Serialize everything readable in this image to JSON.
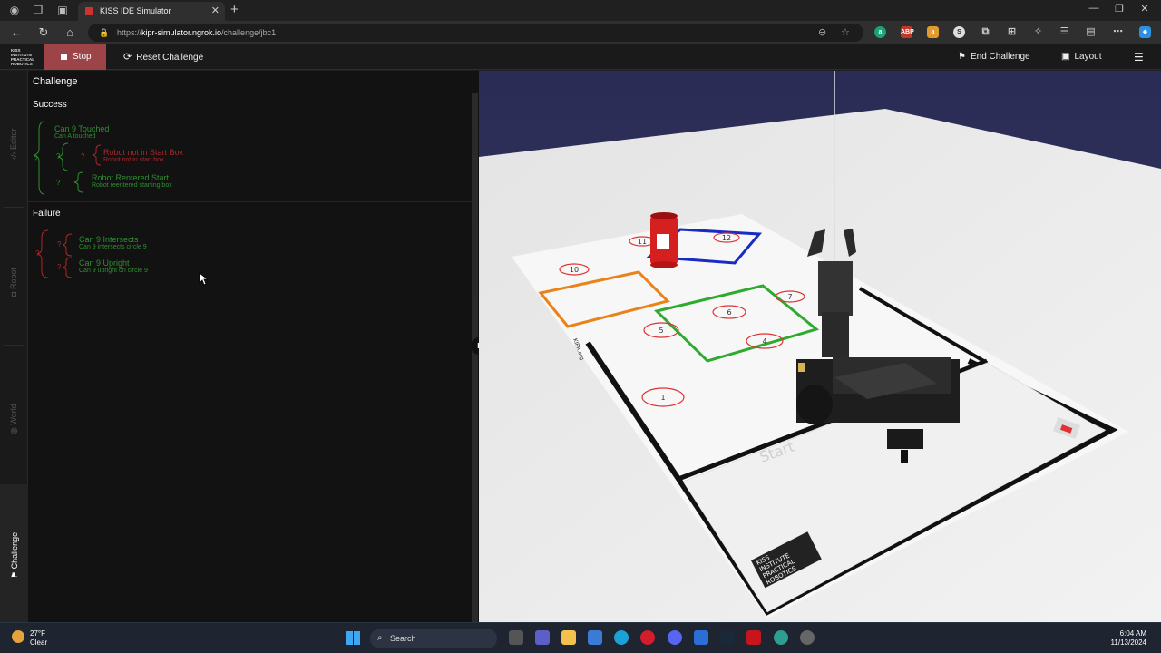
{
  "browser": {
    "tab_title": "KISS IDE Simulator",
    "url_prefix": "https://",
    "url_host": "kipr-simulator.ngrok.io",
    "url_path": "/challenge/jbc1"
  },
  "toolbar": {
    "stop_label": "Stop",
    "reset_label": "Reset Challenge",
    "end_label": "End Challenge",
    "layout_label": "Layout"
  },
  "logo_lines": [
    "KISS",
    "INSTITUTE",
    "PRACTICAL",
    "ROBOTICS"
  ],
  "side_tabs": {
    "editor": "Editor",
    "robot": "Robot",
    "world": "World",
    "challenge": "Challenge"
  },
  "panel": {
    "title": "Challenge",
    "success": {
      "title": "Success",
      "can_touched": {
        "name": "Can 9 Touched",
        "desc": "Can A touched"
      },
      "not_in_start": {
        "name": "Robot not in Start Box",
        "desc": "Robot not in start box"
      },
      "reentered": {
        "name": "Robot Rentered Start",
        "desc": "Robot reentered starting box"
      }
    },
    "failure": {
      "title": "Failure",
      "intersects": {
        "name": "Can 9 Intersects",
        "desc": "Can 9 intersects circle 9"
      },
      "upright": {
        "name": "Can 9 Upright",
        "desc": "Can 9 upright on circle 9"
      }
    },
    "q": "?"
  },
  "scene": {
    "start_label": "Start",
    "circles": [
      "1",
      "4",
      "5",
      "6",
      "7",
      "10",
      "11",
      "12"
    ],
    "mat_logo": [
      "KISS",
      "INSTITUTE",
      "PRACTICAL",
      "ROBOTICS"
    ],
    "mat_side": "KIPR.org"
  },
  "taskbar": {
    "temp": "27°F",
    "weather": "Clear",
    "search": "Search",
    "time": "6:04 AM",
    "date": "11/13/2024"
  },
  "colors": {
    "stop": "#9c4448",
    "met": "#2f8f2f",
    "unmet": "#a82828",
    "sky": "#2b2d52"
  }
}
